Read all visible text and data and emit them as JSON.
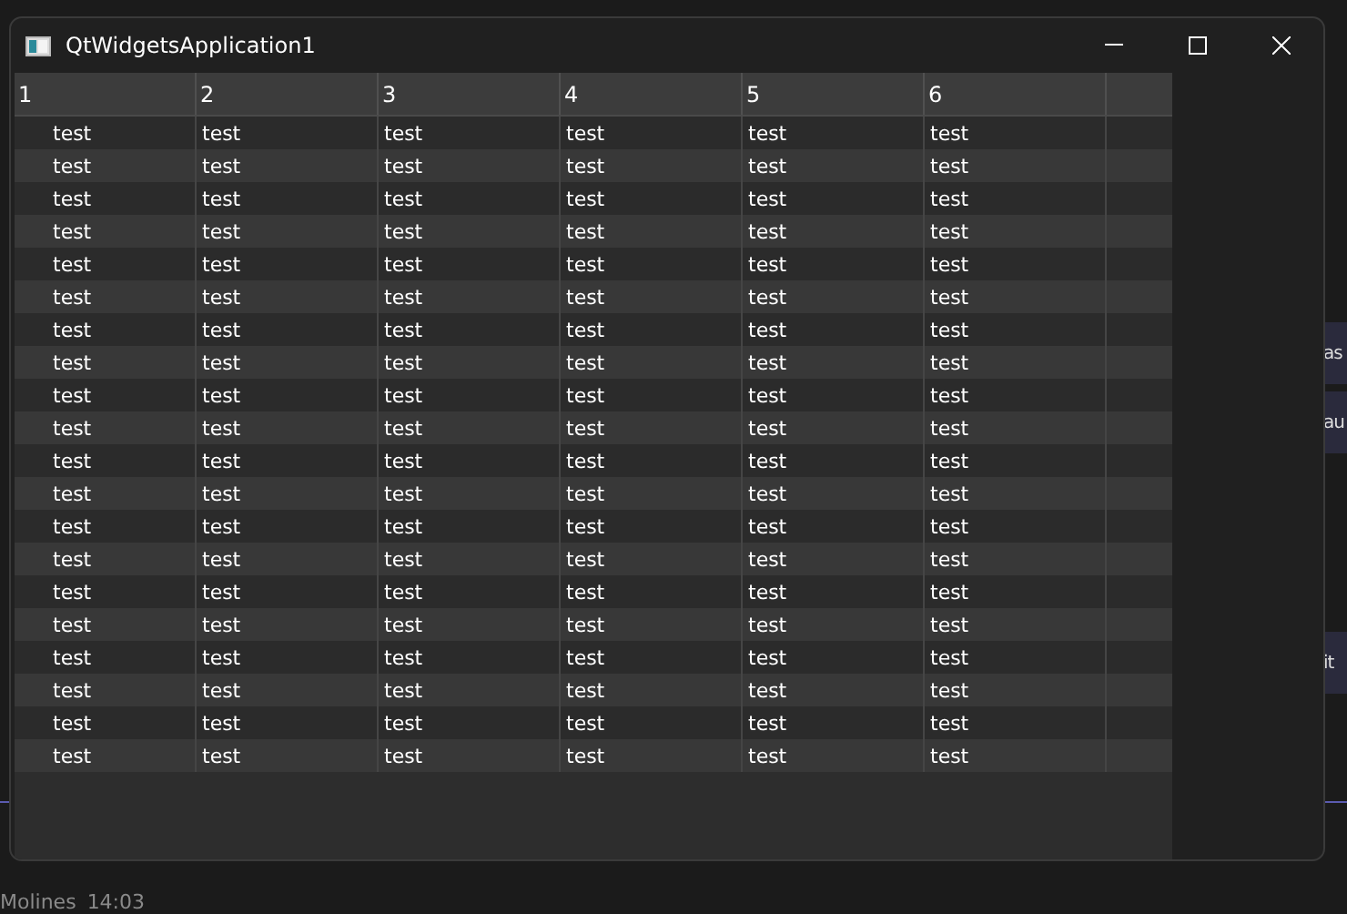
{
  "background_app": {
    "bubbles": [
      {
        "text": "as"
      },
      {
        "text": "au"
      },
      {
        "text": "it"
      }
    ],
    "message_author": "Molines",
    "message_time": "14:03"
  },
  "window": {
    "title": "QtWidgetsApplication1"
  },
  "table": {
    "columns": [
      "1",
      "2",
      "3",
      "4",
      "5",
      "6"
    ],
    "rows": [
      [
        "test",
        "test",
        "test",
        "test",
        "test",
        "test"
      ],
      [
        "test",
        "test",
        "test",
        "test",
        "test",
        "test"
      ],
      [
        "test",
        "test",
        "test",
        "test",
        "test",
        "test"
      ],
      [
        "test",
        "test",
        "test",
        "test",
        "test",
        "test"
      ],
      [
        "test",
        "test",
        "test",
        "test",
        "test",
        "test"
      ],
      [
        "test",
        "test",
        "test",
        "test",
        "test",
        "test"
      ],
      [
        "test",
        "test",
        "test",
        "test",
        "test",
        "test"
      ],
      [
        "test",
        "test",
        "test",
        "test",
        "test",
        "test"
      ],
      [
        "test",
        "test",
        "test",
        "test",
        "test",
        "test"
      ],
      [
        "test",
        "test",
        "test",
        "test",
        "test",
        "test"
      ],
      [
        "test",
        "test",
        "test",
        "test",
        "test",
        "test"
      ],
      [
        "test",
        "test",
        "test",
        "test",
        "test",
        "test"
      ],
      [
        "test",
        "test",
        "test",
        "test",
        "test",
        "test"
      ],
      [
        "test",
        "test",
        "test",
        "test",
        "test",
        "test"
      ],
      [
        "test",
        "test",
        "test",
        "test",
        "test",
        "test"
      ],
      [
        "test",
        "test",
        "test",
        "test",
        "test",
        "test"
      ],
      [
        "test",
        "test",
        "test",
        "test",
        "test",
        "test"
      ],
      [
        "test",
        "test",
        "test",
        "test",
        "test",
        "test"
      ],
      [
        "test",
        "test",
        "test",
        "test",
        "test",
        "test"
      ],
      [
        "test",
        "test",
        "test",
        "test",
        "test",
        "test"
      ]
    ]
  }
}
